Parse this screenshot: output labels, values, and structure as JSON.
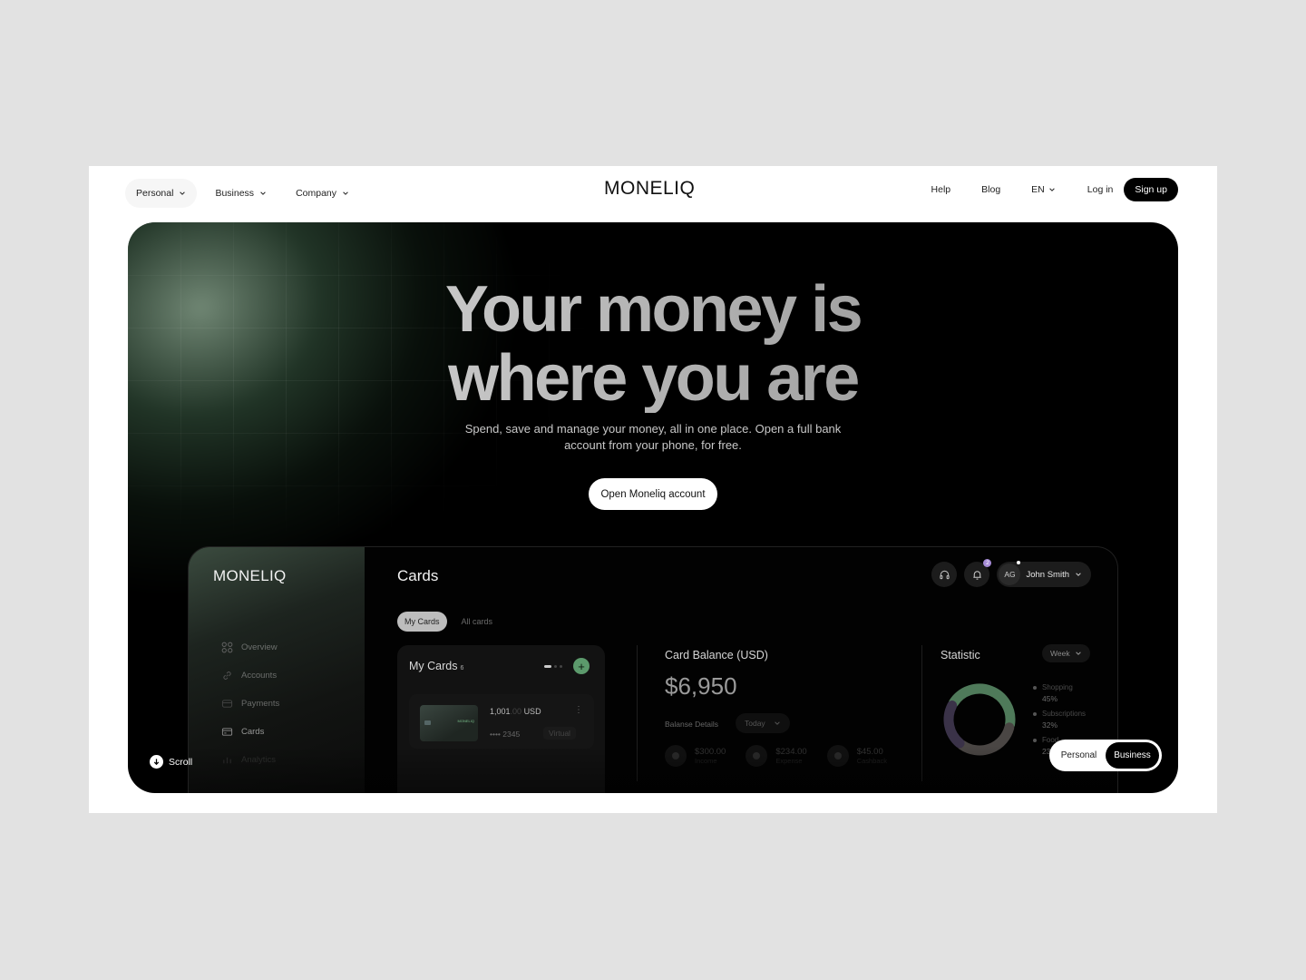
{
  "nav": {
    "left": [
      {
        "label": "Personal",
        "active": true
      },
      {
        "label": "Business",
        "active": false
      },
      {
        "label": "Company",
        "active": false
      }
    ],
    "logo": "MONELIQ",
    "right": {
      "help": "Help",
      "blog": "Blog",
      "language": "EN",
      "login": "Log in",
      "signup": "Sign up"
    }
  },
  "hero": {
    "headline_line1": "Your money is",
    "headline_line2": "where you are",
    "subtitle": "Spend, save and manage your money, all in one place. Open a full bank account from your phone, for free.",
    "cta": "Open Moneliq account",
    "scroll_label": "Scroll"
  },
  "dashboard": {
    "logo": "MONELIQ",
    "sidebar": [
      {
        "label": "Overview",
        "icon": "grid-icon"
      },
      {
        "label": "Accounts",
        "icon": "link-icon"
      },
      {
        "label": "Payments",
        "icon": "wallet-icon"
      },
      {
        "label": "Cards",
        "icon": "card-icon"
      },
      {
        "label": "Analytics",
        "icon": "chart-icon"
      }
    ],
    "title": "Cards",
    "tabs": [
      {
        "label": "My Cards",
        "active": true
      },
      {
        "label": "All cards",
        "active": false
      }
    ],
    "notification_count": "2",
    "user": {
      "initials": "AG",
      "name": "John Smith"
    },
    "my_cards": {
      "title": "My Cards",
      "count": "6",
      "card": {
        "brand": "MONELIQ",
        "amount": "1,001",
        "decimals": ".00",
        "currency": "USD",
        "number": "•••• 2345",
        "type": "Virtual"
      }
    },
    "balance": {
      "label": "Card Balance (USD)",
      "value": "$6,950",
      "details_label": "Balanse Details",
      "period": "Today",
      "items": [
        {
          "amount": "$300.00",
          "label": "Income"
        },
        {
          "amount": "$234.00",
          "label": "Expense"
        },
        {
          "amount": "$45.00",
          "label": "Cashback"
        }
      ]
    },
    "statistic": {
      "label": "Statistic",
      "period": "Week",
      "segments": [
        {
          "name": "Shopping",
          "percent": 45,
          "label": "45%",
          "color": "#4f7a5a"
        },
        {
          "name": "Subscriptions",
          "percent": 32,
          "label": "32%",
          "color": "#4a4644"
        },
        {
          "name": "Food",
          "percent": 23,
          "label": "23%",
          "color": "#3a3248"
        }
      ]
    }
  },
  "toggle": {
    "personal": "Personal",
    "business": "Business",
    "active": "Business"
  }
}
